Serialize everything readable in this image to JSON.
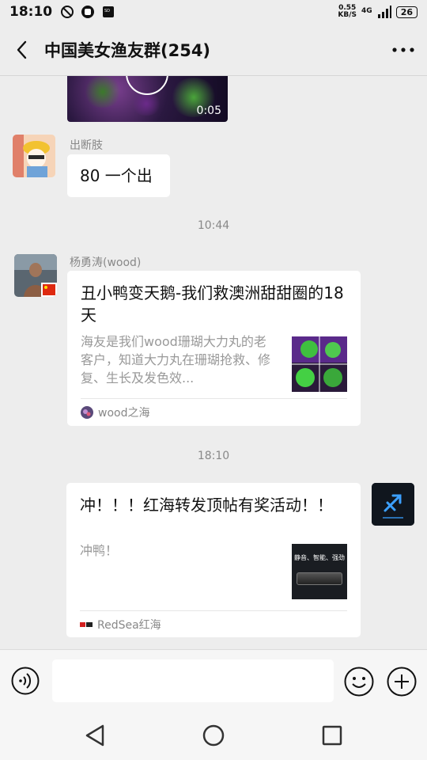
{
  "status_bar": {
    "time": "18:10",
    "net_speed_value": "0.55",
    "net_speed_unit": "KB/S",
    "network_type": "4G",
    "battery": "26"
  },
  "header": {
    "title": "中国美女渔友群(254)"
  },
  "chat": {
    "video": {
      "duration": "0:05"
    },
    "messages": [
      {
        "sender": "出断肢",
        "text": "80 一个出"
      },
      {
        "timestamp": "10:44"
      },
      {
        "sender": "杨勇涛(wood)",
        "card_title": "丑小鸭变天鹅-我们救澳洲甜甜圈的18天",
        "card_desc": "海友是我们wood珊瑚大力丸的老客户，知道大力丸在珊瑚抢救、修复、生长及发色效...",
        "card_source": "wood之海"
      },
      {
        "timestamp": "18:10"
      },
      {
        "card_title": "冲！！！红海转发顶帖有奖活动！！",
        "card_desc": "冲鸭！",
        "card_thumb_text": "静音、智能、强劲",
        "card_source": "RedSea红海"
      }
    ]
  },
  "input_bar": {
    "placeholder": ""
  },
  "colors": {
    "background": "#ededed",
    "bubble": "#ffffff",
    "meta_text": "#888888"
  }
}
